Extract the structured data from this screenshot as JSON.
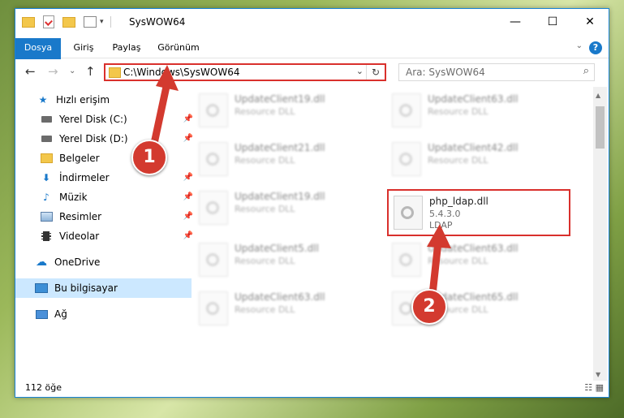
{
  "window": {
    "title": "SysWOW64",
    "controls": {
      "minimize": "—",
      "maximize": "☐",
      "close": "✕"
    }
  },
  "ribbon": {
    "tabs": [
      "Dosya",
      "Giriş",
      "Paylaş",
      "Görünüm"
    ],
    "collapse": "⌄",
    "help": "?"
  },
  "nav": {
    "back": "←",
    "forward": "→",
    "recent": "⌄",
    "up": "↑",
    "address_path": "C:\\Windows\\SysWOW64",
    "address_dropdown": "⌄",
    "refresh": "↻",
    "search_placeholder": "Ara: SysWOW64",
    "search_icon": "⌕"
  },
  "sidebar": {
    "items": [
      {
        "label": "Hızlı erişim",
        "icon": "star-icon"
      },
      {
        "label": "Yerel Disk (C:)",
        "icon": "drive-icon",
        "pinned": true
      },
      {
        "label": "Yerel Disk (D:)",
        "icon": "drive-icon",
        "pinned": true
      },
      {
        "label": "Belgeler",
        "icon": "folder-icon"
      },
      {
        "label": "İndirmeler",
        "icon": "download-icon",
        "pinned": true
      },
      {
        "label": "Müzik",
        "icon": "music-icon",
        "pinned": true
      },
      {
        "label": "Resimler",
        "icon": "pictures-icon",
        "pinned": true
      },
      {
        "label": "Videolar",
        "icon": "video-icon",
        "pinned": true
      },
      {
        "label": "OneDrive",
        "icon": "cloud-icon"
      },
      {
        "label": "Bu bilgisayar",
        "icon": "computer-icon",
        "selected": true
      },
      {
        "label": "Ağ",
        "icon": "network-icon"
      }
    ],
    "pin_glyph": "📌"
  },
  "files": [
    {
      "name": "UpdateClient19.dll",
      "desc": "Resource DLL"
    },
    {
      "name": "UpdateClient63.dll",
      "desc": "Resource DLL"
    },
    {
      "name": "UpdateClient21.dll",
      "desc": "Resource DLL"
    },
    {
      "name": "UpdateClient42.dll",
      "desc": "Resource DLL"
    },
    {
      "name": "UpdateClient19.dll",
      "desc": "Resource DLL"
    },
    {
      "name": "php_ldap.dll",
      "version": "5.4.3.0",
      "desc": "LDAP",
      "highlighted": true
    },
    {
      "name": "UpdateClient5.dll",
      "desc": "Resource DLL"
    },
    {
      "name": "UpdateClient63.dll",
      "desc": "Resource DLL"
    },
    {
      "name": "UpdateClient63.dll",
      "desc": "Resource DLL"
    },
    {
      "name": "UpdateClient65.dll",
      "desc": "Resource DLL"
    }
  ],
  "status": {
    "count": "112 öğe",
    "views": "☷ ▦"
  },
  "markers": [
    "1",
    "2"
  ],
  "colors": {
    "accent": "#1979ca",
    "highlight": "#d9302c",
    "selection": "#cce8ff"
  }
}
